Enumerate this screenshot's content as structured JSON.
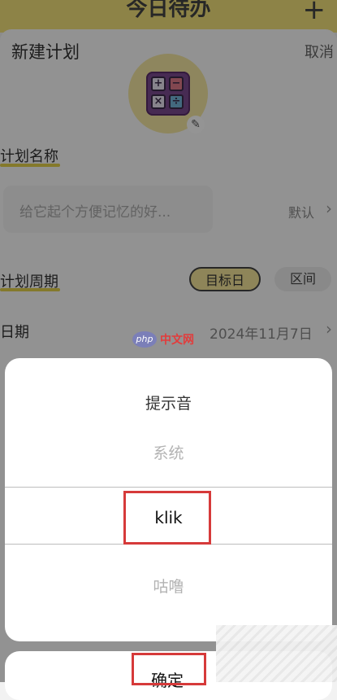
{
  "app": {
    "top_title": "今日待办",
    "top_plus": "+",
    "header_title": "新建计划",
    "header_cancel": "取消"
  },
  "form": {
    "name_label": "计划名称",
    "name_placeholder": "给它起个方便记忆的好...",
    "name_default": "默认",
    "period_label": "计划周期",
    "period_options": [
      "目标日",
      "区间"
    ],
    "date_label": "日期",
    "date_value": "2024年11月7日"
  },
  "dialog": {
    "title": "提示音",
    "options": [
      "系统",
      "klik",
      "咕噜"
    ],
    "selected": "klik",
    "confirm": "确定"
  },
  "watermark": {
    "logo": "php",
    "text": "中文网"
  },
  "colors": {
    "accent_yellow": "#f3e27a",
    "highlight_box": "#d63a3a"
  }
}
